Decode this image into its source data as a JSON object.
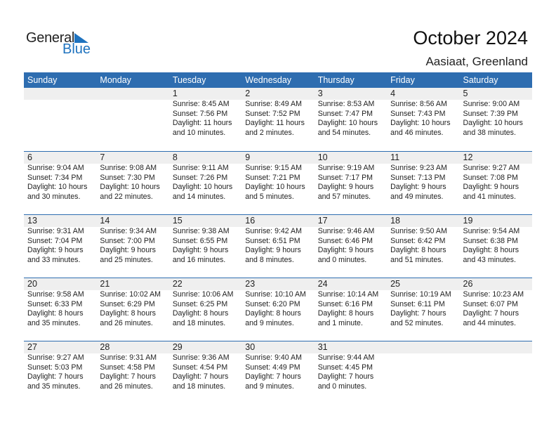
{
  "logo": {
    "word1": "General",
    "word2": "Blue",
    "accent_color": "#1f73bf"
  },
  "header": {
    "title": "October 2024",
    "location": "Aasiaat, Greenland"
  },
  "colors": {
    "header_bg": "#2e6db0",
    "date_band_bg": "#efefef"
  },
  "weekdays": [
    "Sunday",
    "Monday",
    "Tuesday",
    "Wednesday",
    "Thursday",
    "Friday",
    "Saturday"
  ],
  "weeks": [
    [
      {
        "day": "",
        "sunrise": "",
        "sunset": "",
        "daylight1": "",
        "daylight2": ""
      },
      {
        "day": "",
        "sunrise": "",
        "sunset": "",
        "daylight1": "",
        "daylight2": ""
      },
      {
        "day": "1",
        "sunrise": "Sunrise: 8:45 AM",
        "sunset": "Sunset: 7:56 PM",
        "daylight1": "Daylight: 11 hours",
        "daylight2": "and 10 minutes."
      },
      {
        "day": "2",
        "sunrise": "Sunrise: 8:49 AM",
        "sunset": "Sunset: 7:52 PM",
        "daylight1": "Daylight: 11 hours",
        "daylight2": "and 2 minutes."
      },
      {
        "day": "3",
        "sunrise": "Sunrise: 8:53 AM",
        "sunset": "Sunset: 7:47 PM",
        "daylight1": "Daylight: 10 hours",
        "daylight2": "and 54 minutes."
      },
      {
        "day": "4",
        "sunrise": "Sunrise: 8:56 AM",
        "sunset": "Sunset: 7:43 PM",
        "daylight1": "Daylight: 10 hours",
        "daylight2": "and 46 minutes."
      },
      {
        "day": "5",
        "sunrise": "Sunrise: 9:00 AM",
        "sunset": "Sunset: 7:39 PM",
        "daylight1": "Daylight: 10 hours",
        "daylight2": "and 38 minutes."
      }
    ],
    [
      {
        "day": "6",
        "sunrise": "Sunrise: 9:04 AM",
        "sunset": "Sunset: 7:34 PM",
        "daylight1": "Daylight: 10 hours",
        "daylight2": "and 30 minutes."
      },
      {
        "day": "7",
        "sunrise": "Sunrise: 9:08 AM",
        "sunset": "Sunset: 7:30 PM",
        "daylight1": "Daylight: 10 hours",
        "daylight2": "and 22 minutes."
      },
      {
        "day": "8",
        "sunrise": "Sunrise: 9:11 AM",
        "sunset": "Sunset: 7:26 PM",
        "daylight1": "Daylight: 10 hours",
        "daylight2": "and 14 minutes."
      },
      {
        "day": "9",
        "sunrise": "Sunrise: 9:15 AM",
        "sunset": "Sunset: 7:21 PM",
        "daylight1": "Daylight: 10 hours",
        "daylight2": "and 5 minutes."
      },
      {
        "day": "10",
        "sunrise": "Sunrise: 9:19 AM",
        "sunset": "Sunset: 7:17 PM",
        "daylight1": "Daylight: 9 hours",
        "daylight2": "and 57 minutes."
      },
      {
        "day": "11",
        "sunrise": "Sunrise: 9:23 AM",
        "sunset": "Sunset: 7:13 PM",
        "daylight1": "Daylight: 9 hours",
        "daylight2": "and 49 minutes."
      },
      {
        "day": "12",
        "sunrise": "Sunrise: 9:27 AM",
        "sunset": "Sunset: 7:08 PM",
        "daylight1": "Daylight: 9 hours",
        "daylight2": "and 41 minutes."
      }
    ],
    [
      {
        "day": "13",
        "sunrise": "Sunrise: 9:31 AM",
        "sunset": "Sunset: 7:04 PM",
        "daylight1": "Daylight: 9 hours",
        "daylight2": "and 33 minutes."
      },
      {
        "day": "14",
        "sunrise": "Sunrise: 9:34 AM",
        "sunset": "Sunset: 7:00 PM",
        "daylight1": "Daylight: 9 hours",
        "daylight2": "and 25 minutes."
      },
      {
        "day": "15",
        "sunrise": "Sunrise: 9:38 AM",
        "sunset": "Sunset: 6:55 PM",
        "daylight1": "Daylight: 9 hours",
        "daylight2": "and 16 minutes."
      },
      {
        "day": "16",
        "sunrise": "Sunrise: 9:42 AM",
        "sunset": "Sunset: 6:51 PM",
        "daylight1": "Daylight: 9 hours",
        "daylight2": "and 8 minutes."
      },
      {
        "day": "17",
        "sunrise": "Sunrise: 9:46 AM",
        "sunset": "Sunset: 6:46 PM",
        "daylight1": "Daylight: 9 hours",
        "daylight2": "and 0 minutes."
      },
      {
        "day": "18",
        "sunrise": "Sunrise: 9:50 AM",
        "sunset": "Sunset: 6:42 PM",
        "daylight1": "Daylight: 8 hours",
        "daylight2": "and 51 minutes."
      },
      {
        "day": "19",
        "sunrise": "Sunrise: 9:54 AM",
        "sunset": "Sunset: 6:38 PM",
        "daylight1": "Daylight: 8 hours",
        "daylight2": "and 43 minutes."
      }
    ],
    [
      {
        "day": "20",
        "sunrise": "Sunrise: 9:58 AM",
        "sunset": "Sunset: 6:33 PM",
        "daylight1": "Daylight: 8 hours",
        "daylight2": "and 35 minutes."
      },
      {
        "day": "21",
        "sunrise": "Sunrise: 10:02 AM",
        "sunset": "Sunset: 6:29 PM",
        "daylight1": "Daylight: 8 hours",
        "daylight2": "and 26 minutes."
      },
      {
        "day": "22",
        "sunrise": "Sunrise: 10:06 AM",
        "sunset": "Sunset: 6:25 PM",
        "daylight1": "Daylight: 8 hours",
        "daylight2": "and 18 minutes."
      },
      {
        "day": "23",
        "sunrise": "Sunrise: 10:10 AM",
        "sunset": "Sunset: 6:20 PM",
        "daylight1": "Daylight: 8 hours",
        "daylight2": "and 9 minutes."
      },
      {
        "day": "24",
        "sunrise": "Sunrise: 10:14 AM",
        "sunset": "Sunset: 6:16 PM",
        "daylight1": "Daylight: 8 hours",
        "daylight2": "and 1 minute."
      },
      {
        "day": "25",
        "sunrise": "Sunrise: 10:19 AM",
        "sunset": "Sunset: 6:11 PM",
        "daylight1": "Daylight: 7 hours",
        "daylight2": "and 52 minutes."
      },
      {
        "day": "26",
        "sunrise": "Sunrise: 10:23 AM",
        "sunset": "Sunset: 6:07 PM",
        "daylight1": "Daylight: 7 hours",
        "daylight2": "and 44 minutes."
      }
    ],
    [
      {
        "day": "27",
        "sunrise": "Sunrise: 9:27 AM",
        "sunset": "Sunset: 5:03 PM",
        "daylight1": "Daylight: 7 hours",
        "daylight2": "and 35 minutes."
      },
      {
        "day": "28",
        "sunrise": "Sunrise: 9:31 AM",
        "sunset": "Sunset: 4:58 PM",
        "daylight1": "Daylight: 7 hours",
        "daylight2": "and 26 minutes."
      },
      {
        "day": "29",
        "sunrise": "Sunrise: 9:36 AM",
        "sunset": "Sunset: 4:54 PM",
        "daylight1": "Daylight: 7 hours",
        "daylight2": "and 18 minutes."
      },
      {
        "day": "30",
        "sunrise": "Sunrise: 9:40 AM",
        "sunset": "Sunset: 4:49 PM",
        "daylight1": "Daylight: 7 hours",
        "daylight2": "and 9 minutes."
      },
      {
        "day": "31",
        "sunrise": "Sunrise: 9:44 AM",
        "sunset": "Sunset: 4:45 PM",
        "daylight1": "Daylight: 7 hours",
        "daylight2": "and 0 minutes."
      },
      {
        "day": "",
        "sunrise": "",
        "sunset": "",
        "daylight1": "",
        "daylight2": ""
      },
      {
        "day": "",
        "sunrise": "",
        "sunset": "",
        "daylight1": "",
        "daylight2": ""
      }
    ]
  ]
}
